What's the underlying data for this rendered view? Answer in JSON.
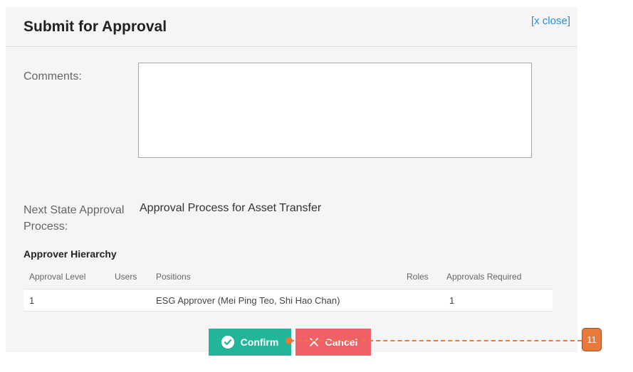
{
  "dialog": {
    "title": "Submit for Approval",
    "close_label": "[x close]"
  },
  "comments": {
    "label": "Comments:",
    "value": ""
  },
  "next_state": {
    "label": "Next State Approval Process:",
    "value": "Approval Process for Asset Transfer"
  },
  "hierarchy": {
    "title": "Approver Hierarchy",
    "columns": [
      "Approval Level",
      "Users",
      "Positions",
      "Roles",
      "Approvals Required"
    ],
    "rows": [
      {
        "approval_level": "1",
        "users": "",
        "positions": "ESG Approver (Mei Ping Teo, Shi Hao Chan)",
        "roles": "",
        "approvals_required": "1"
      }
    ]
  },
  "buttons": {
    "confirm_label": "Confirm",
    "cancel_label": "Cancel"
  },
  "annotation": {
    "badge": "11"
  },
  "colors": {
    "confirm": "#22b59a",
    "cancel": "#f16066",
    "link": "#2a8fd6",
    "annotation": "#e8793a"
  }
}
